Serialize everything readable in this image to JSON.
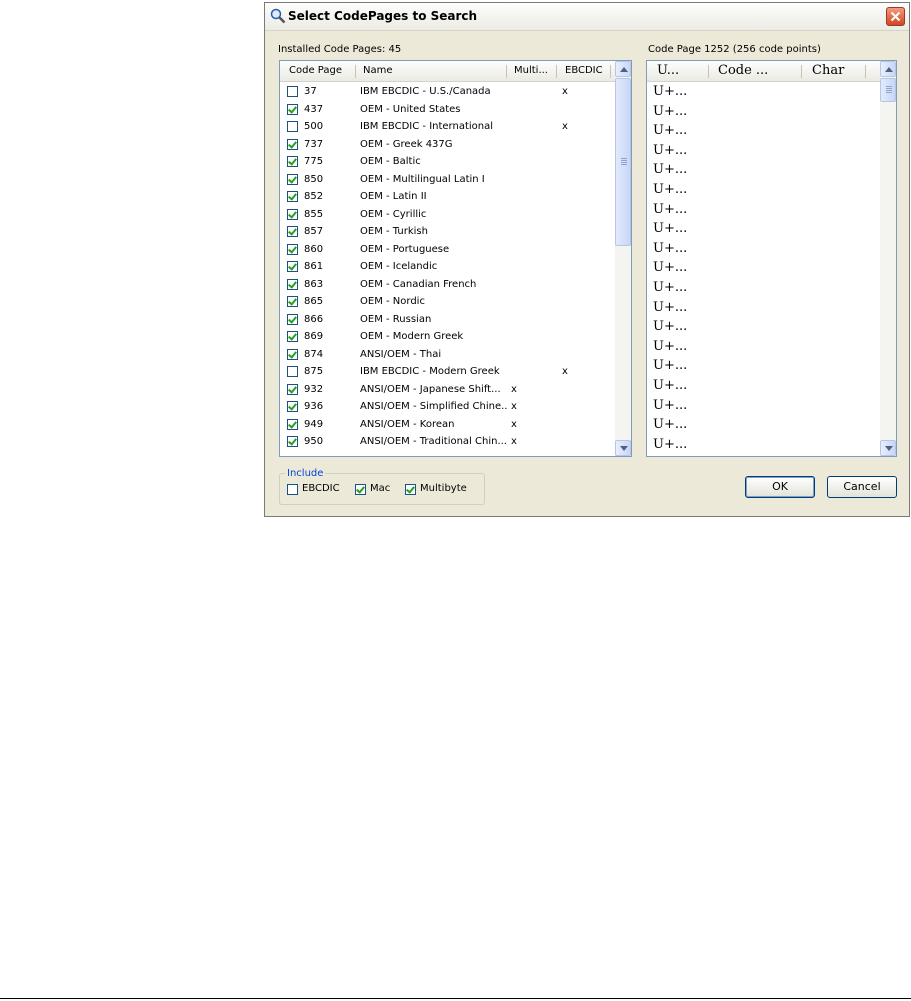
{
  "window": {
    "title": "Select CodePages to Search",
    "icon": "find-icon"
  },
  "installed": {
    "label": "Installed Code Pages: 45",
    "columns": [
      "Code Page",
      "Name",
      "Multi...",
      "EBCDIC"
    ],
    "rows": [
      {
        "checked": false,
        "code": "37",
        "name": "IBM EBCDIC - U.S./Canada",
        "multi": "",
        "ebcdic": "x"
      },
      {
        "checked": true,
        "code": "437",
        "name": "OEM - United States",
        "multi": "",
        "ebcdic": ""
      },
      {
        "checked": false,
        "code": "500",
        "name": "IBM EBCDIC - International",
        "multi": "",
        "ebcdic": "x"
      },
      {
        "checked": true,
        "code": "737",
        "name": "OEM - Greek 437G",
        "multi": "",
        "ebcdic": ""
      },
      {
        "checked": true,
        "code": "775",
        "name": "OEM - Baltic",
        "multi": "",
        "ebcdic": ""
      },
      {
        "checked": true,
        "code": "850",
        "name": "OEM - Multilingual Latin I",
        "multi": "",
        "ebcdic": ""
      },
      {
        "checked": true,
        "code": "852",
        "name": "OEM - Latin II",
        "multi": "",
        "ebcdic": ""
      },
      {
        "checked": true,
        "code": "855",
        "name": "OEM - Cyrillic",
        "multi": "",
        "ebcdic": ""
      },
      {
        "checked": true,
        "code": "857",
        "name": "OEM - Turkish",
        "multi": "",
        "ebcdic": ""
      },
      {
        "checked": true,
        "code": "860",
        "name": "OEM - Portuguese",
        "multi": "",
        "ebcdic": ""
      },
      {
        "checked": true,
        "code": "861",
        "name": "OEM - Icelandic",
        "multi": "",
        "ebcdic": ""
      },
      {
        "checked": true,
        "code": "863",
        "name": "OEM - Canadian French",
        "multi": "",
        "ebcdic": ""
      },
      {
        "checked": true,
        "code": "865",
        "name": "OEM - Nordic",
        "multi": "",
        "ebcdic": ""
      },
      {
        "checked": true,
        "code": "866",
        "name": "OEM - Russian",
        "multi": "",
        "ebcdic": ""
      },
      {
        "checked": true,
        "code": "869",
        "name": "OEM - Modern Greek",
        "multi": "",
        "ebcdic": ""
      },
      {
        "checked": true,
        "code": "874",
        "name": "ANSI/OEM - Thai",
        "multi": "",
        "ebcdic": ""
      },
      {
        "checked": false,
        "code": "875",
        "name": "IBM EBCDIC - Modern Greek",
        "multi": "",
        "ebcdic": "x"
      },
      {
        "checked": true,
        "code": "932",
        "name": "ANSI/OEM - Japanese Shift...",
        "multi": "x",
        "ebcdic": ""
      },
      {
        "checked": true,
        "code": "936",
        "name": "ANSI/OEM - Simplified Chine...",
        "multi": "x",
        "ebcdic": ""
      },
      {
        "checked": true,
        "code": "949",
        "name": "ANSI/OEM - Korean",
        "multi": "x",
        "ebcdic": ""
      },
      {
        "checked": true,
        "code": "950",
        "name": "ANSI/OEM - Traditional Chin...",
        "multi": "x",
        "ebcdic": ""
      }
    ]
  },
  "codepoints": {
    "label": "Code Page  1252 (256 code points)",
    "columns": [
      "U...",
      "Code ...",
      "Char"
    ],
    "rows": [
      "U+...",
      "U+...",
      "U+...",
      "U+...",
      "U+...",
      "U+...",
      "U+...",
      "U+...",
      "U+...",
      "U+...",
      "U+...",
      "U+...",
      "U+...",
      "U+...",
      "U+...",
      "U+...",
      "U+...",
      "U+...",
      "U+..."
    ]
  },
  "include": {
    "label": "Include",
    "options": [
      {
        "label": "EBCDIC",
        "checked": false
      },
      {
        "label": "Mac",
        "checked": true
      },
      {
        "label": "Multibyte",
        "checked": true
      }
    ]
  },
  "buttons": {
    "ok": "OK",
    "cancel": "Cancel"
  }
}
